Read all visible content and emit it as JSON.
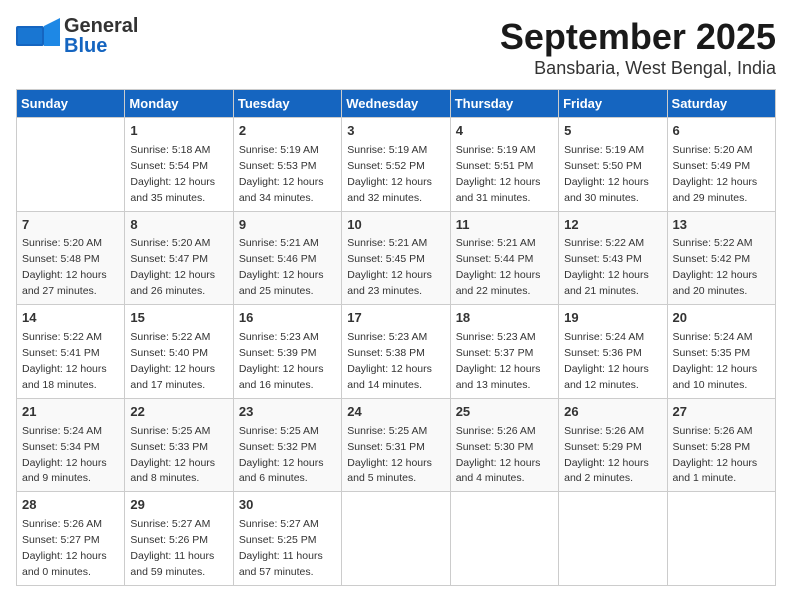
{
  "header": {
    "logo_general": "General",
    "logo_blue": "Blue",
    "month": "September 2025",
    "location": "Bansbaria, West Bengal, India"
  },
  "days_of_week": [
    "Sunday",
    "Monday",
    "Tuesday",
    "Wednesday",
    "Thursday",
    "Friday",
    "Saturday"
  ],
  "weeks": [
    [
      {
        "num": "",
        "info": ""
      },
      {
        "num": "1",
        "info": "Sunrise: 5:18 AM\nSunset: 5:54 PM\nDaylight: 12 hours\nand 35 minutes."
      },
      {
        "num": "2",
        "info": "Sunrise: 5:19 AM\nSunset: 5:53 PM\nDaylight: 12 hours\nand 34 minutes."
      },
      {
        "num": "3",
        "info": "Sunrise: 5:19 AM\nSunset: 5:52 PM\nDaylight: 12 hours\nand 32 minutes."
      },
      {
        "num": "4",
        "info": "Sunrise: 5:19 AM\nSunset: 5:51 PM\nDaylight: 12 hours\nand 31 minutes."
      },
      {
        "num": "5",
        "info": "Sunrise: 5:19 AM\nSunset: 5:50 PM\nDaylight: 12 hours\nand 30 minutes."
      },
      {
        "num": "6",
        "info": "Sunrise: 5:20 AM\nSunset: 5:49 PM\nDaylight: 12 hours\nand 29 minutes."
      }
    ],
    [
      {
        "num": "7",
        "info": "Sunrise: 5:20 AM\nSunset: 5:48 PM\nDaylight: 12 hours\nand 27 minutes."
      },
      {
        "num": "8",
        "info": "Sunrise: 5:20 AM\nSunset: 5:47 PM\nDaylight: 12 hours\nand 26 minutes."
      },
      {
        "num": "9",
        "info": "Sunrise: 5:21 AM\nSunset: 5:46 PM\nDaylight: 12 hours\nand 25 minutes."
      },
      {
        "num": "10",
        "info": "Sunrise: 5:21 AM\nSunset: 5:45 PM\nDaylight: 12 hours\nand 23 minutes."
      },
      {
        "num": "11",
        "info": "Sunrise: 5:21 AM\nSunset: 5:44 PM\nDaylight: 12 hours\nand 22 minutes."
      },
      {
        "num": "12",
        "info": "Sunrise: 5:22 AM\nSunset: 5:43 PM\nDaylight: 12 hours\nand 21 minutes."
      },
      {
        "num": "13",
        "info": "Sunrise: 5:22 AM\nSunset: 5:42 PM\nDaylight: 12 hours\nand 20 minutes."
      }
    ],
    [
      {
        "num": "14",
        "info": "Sunrise: 5:22 AM\nSunset: 5:41 PM\nDaylight: 12 hours\nand 18 minutes."
      },
      {
        "num": "15",
        "info": "Sunrise: 5:22 AM\nSunset: 5:40 PM\nDaylight: 12 hours\nand 17 minutes."
      },
      {
        "num": "16",
        "info": "Sunrise: 5:23 AM\nSunset: 5:39 PM\nDaylight: 12 hours\nand 16 minutes."
      },
      {
        "num": "17",
        "info": "Sunrise: 5:23 AM\nSunset: 5:38 PM\nDaylight: 12 hours\nand 14 minutes."
      },
      {
        "num": "18",
        "info": "Sunrise: 5:23 AM\nSunset: 5:37 PM\nDaylight: 12 hours\nand 13 minutes."
      },
      {
        "num": "19",
        "info": "Sunrise: 5:24 AM\nSunset: 5:36 PM\nDaylight: 12 hours\nand 12 minutes."
      },
      {
        "num": "20",
        "info": "Sunrise: 5:24 AM\nSunset: 5:35 PM\nDaylight: 12 hours\nand 10 minutes."
      }
    ],
    [
      {
        "num": "21",
        "info": "Sunrise: 5:24 AM\nSunset: 5:34 PM\nDaylight: 12 hours\nand 9 minutes."
      },
      {
        "num": "22",
        "info": "Sunrise: 5:25 AM\nSunset: 5:33 PM\nDaylight: 12 hours\nand 8 minutes."
      },
      {
        "num": "23",
        "info": "Sunrise: 5:25 AM\nSunset: 5:32 PM\nDaylight: 12 hours\nand 6 minutes."
      },
      {
        "num": "24",
        "info": "Sunrise: 5:25 AM\nSunset: 5:31 PM\nDaylight: 12 hours\nand 5 minutes."
      },
      {
        "num": "25",
        "info": "Sunrise: 5:26 AM\nSunset: 5:30 PM\nDaylight: 12 hours\nand 4 minutes."
      },
      {
        "num": "26",
        "info": "Sunrise: 5:26 AM\nSunset: 5:29 PM\nDaylight: 12 hours\nand 2 minutes."
      },
      {
        "num": "27",
        "info": "Sunrise: 5:26 AM\nSunset: 5:28 PM\nDaylight: 12 hours\nand 1 minute."
      }
    ],
    [
      {
        "num": "28",
        "info": "Sunrise: 5:26 AM\nSunset: 5:27 PM\nDaylight: 12 hours\nand 0 minutes."
      },
      {
        "num": "29",
        "info": "Sunrise: 5:27 AM\nSunset: 5:26 PM\nDaylight: 11 hours\nand 59 minutes."
      },
      {
        "num": "30",
        "info": "Sunrise: 5:27 AM\nSunset: 5:25 PM\nDaylight: 11 hours\nand 57 minutes."
      },
      {
        "num": "",
        "info": ""
      },
      {
        "num": "",
        "info": ""
      },
      {
        "num": "",
        "info": ""
      },
      {
        "num": "",
        "info": ""
      }
    ]
  ]
}
